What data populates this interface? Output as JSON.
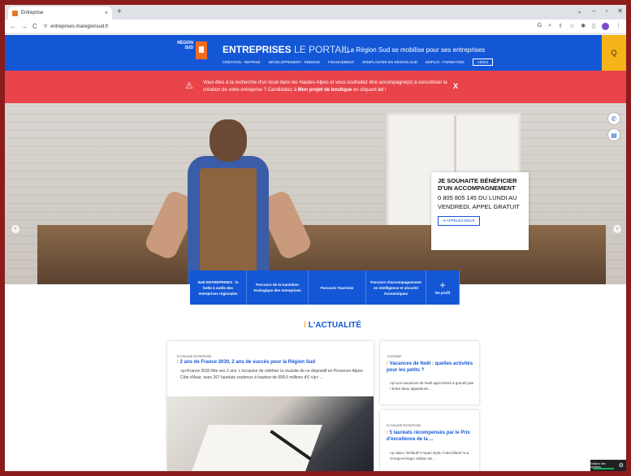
{
  "browser": {
    "tab_title": "Entreprise",
    "tab_close": "×",
    "new_tab": "+",
    "url": "entreprises.maregionsud.fr",
    "nav_back": "←",
    "nav_forward": "→",
    "nav_reload": "C",
    "window_controls": [
      "⌄",
      "–",
      "▫",
      "✕"
    ]
  },
  "header": {
    "logo_text": "RÉGION SUD",
    "brand_main": "ENTREPRISES",
    "brand_sub": " LE PORTAIL",
    "tagline": "La Région Sud se mobilise pour ses entreprises",
    "nav": [
      "CRÉATION - REPRISE",
      "DÉVELOPPEMENT - REBOND",
      "FINANCEMENT",
      "M'IMPLANTER EN RÉGION SUD",
      "EMPLOI - FORMATION",
      "AIDES"
    ],
    "search_label": "Q"
  },
  "alert": {
    "icon": "⚠",
    "text_before": "Vous êtes à la recherche d'un local dans les Hautes-Alpes et vous souhaitez être accompagné(e) à concrétiser la création de votre entreprise ? Candidatez à ",
    "text_bold": "Mon projet de boutique",
    "text_after": " en cliquant ",
    "link": "ici",
    "text_end": " !",
    "close": "X"
  },
  "promo": {
    "heading": "JE SOUHAITE BÉNÉFICIER D'UN ACCOMPAGNEMENT",
    "phone_line": "0 805 805 145 DU LUNDI AU VENDREDI, APPEL GRATUIT",
    "button": "➔ APPELEZ-NOUS"
  },
  "tiles": [
    "SUD ENTREPRISES : la boîte à outils des entreprises régionales",
    "Parcours de la transition écologique des entreprises",
    "Parcours Tourisme",
    "Parcours d'accompagnement en intelligence et sécurité économiques",
    "De profil"
  ],
  "tile_plus": "+",
  "news": {
    "title": "L'ACTUALITÉ",
    "main": {
      "category": "ÉCONOMIE ENTREPRISE",
      "title": "2 ans de France 2030, 2 ans de succès pour la Région Sud",
      "body": "<p>France 2030 fête ses 2 ans. L'occasion de célébrer la réussite de ce dispositif en Provence-Alpes-Côte d'Azur, avec 267 lauréats soutenus à hauteur de 658,5 millions d'€.</p> ..."
    },
    "side1": {
      "category": "TOURISME",
      "title": "Vacances de Noël : quelles activités pour les petits ?",
      "body": "<p>Les vacances de Noël approchent à grands pas ! Entre deux apparitions ..."
    },
    "side2": {
      "category": "ÉCONOMIE ENTREPRISE",
      "title": "5 lauréats récompensés par le Prix d'excellence de la ...",
      "body": "<p class=\"Default\"><span style=\"color:black\">La 2<sup>e</sup> édition de ..."
    }
  },
  "widget": {
    "label": "Gestion des services",
    "gear": "⚙"
  },
  "colors": {
    "brand_blue": "#1357d6",
    "accent_yellow": "#f4b41a",
    "alert_red": "#e8444a",
    "logo_orange": "#f26b1d"
  },
  "icons": {
    "phone": "✆",
    "book": "▤",
    "prev": "‹",
    "next": "›",
    "lock": "🔒",
    "slash": "/"
  }
}
